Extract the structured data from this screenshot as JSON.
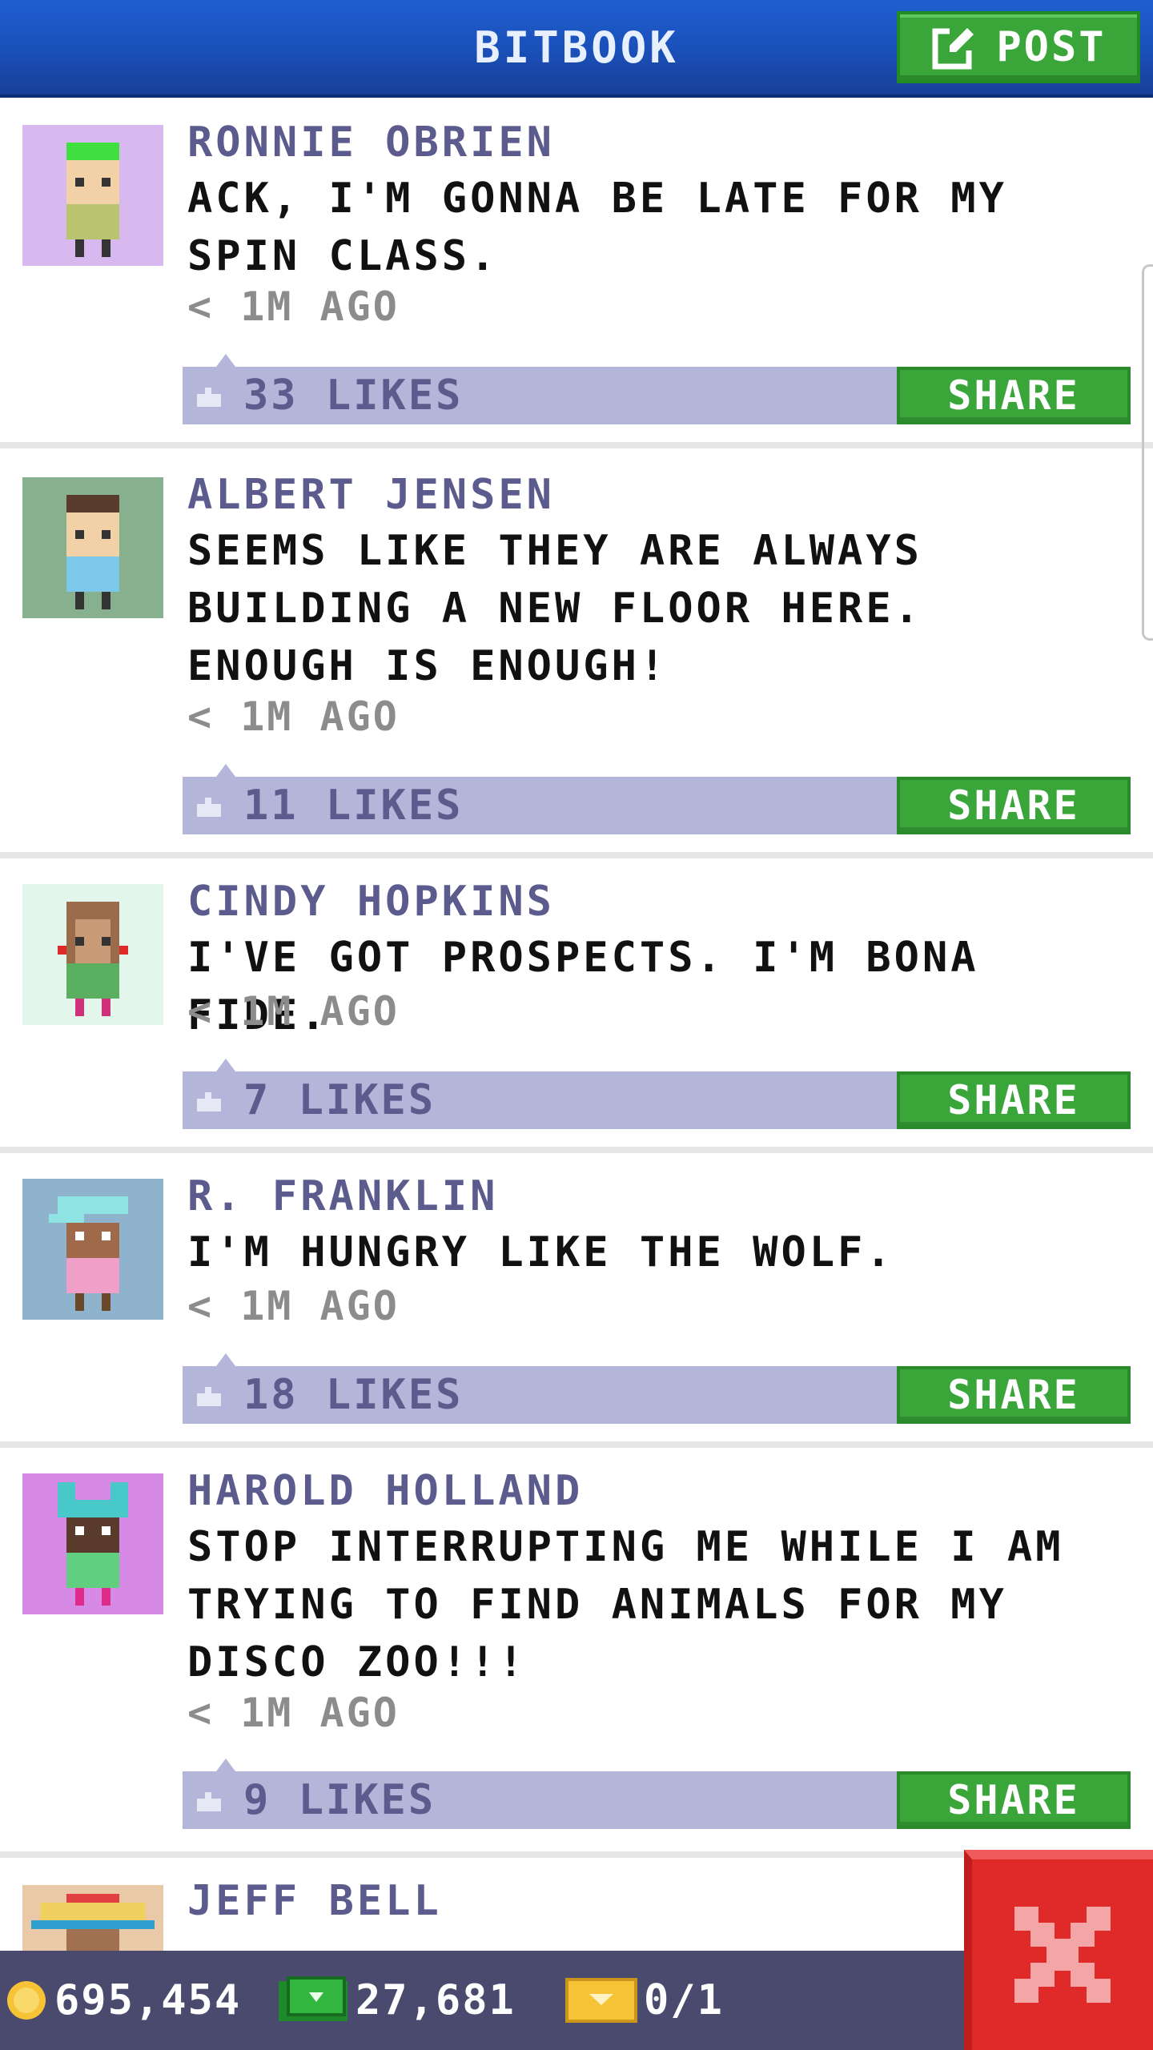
{
  "header": {
    "title": "BITBOOK",
    "post_label": "POST"
  },
  "posts": [
    {
      "author": "RONNIE OBRIEN",
      "message": "ACK, I'M GONNA BE LATE FOR MY SPIN CLASS.",
      "time": "< 1M AGO",
      "likes": "33 LIKES",
      "share_label": "SHARE",
      "avatar_bg": "#d7b8ef"
    },
    {
      "author": "ALBERT JENSEN",
      "message": "SEEMS LIKE THEY ARE ALWAYS BUILDING A NEW FLOOR HERE. ENOUGH IS ENOUGH!",
      "time": "< 1M AGO",
      "likes": "11 LIKES",
      "share_label": "SHARE",
      "avatar_bg": "#86b08e"
    },
    {
      "author": "CINDY HOPKINS",
      "message": "I'VE GOT PROSPECTS. I'M BONA FIDE.",
      "time": "< 1M AGO",
      "likes": "7 LIKES",
      "share_label": "SHARE",
      "avatar_bg": "#e2f6ec"
    },
    {
      "author": "R. FRANKLIN",
      "message": "I'M HUNGRY LIKE THE WOLF.",
      "time": "< 1M AGO",
      "likes": "18 LIKES",
      "share_label": "SHARE",
      "avatar_bg": "#8fb3cc"
    },
    {
      "author": "HAROLD HOLLAND",
      "message": "STOP INTERRUPTING ME WHILE I AM TRYING TO FIND ANIMALS FOR MY DISCO ZOO!!!",
      "time": "< 1M AGO",
      "likes": "9 LIKES",
      "share_label": "SHARE",
      "avatar_bg": "#d68ae6"
    },
    {
      "author": "JEFF BELL",
      "avatar_bg": "#e9c9a8"
    }
  ],
  "footer": {
    "coins": "695,454",
    "bux": "27,681",
    "tickets": "0/1"
  },
  "colors": {
    "header_blue": "#1a4fb8",
    "share_green": "#3aa63a",
    "like_bar": "#b3b6d8",
    "author_purple": "#5b5b8e",
    "close_red": "#e02a2a"
  }
}
